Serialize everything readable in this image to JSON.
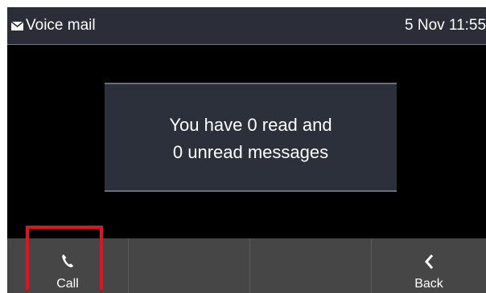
{
  "header": {
    "icon": "envelope-icon",
    "title": "Voice mail",
    "datetime": "5 Nov 11:55"
  },
  "dialog": {
    "line1": "You have 0 read and",
    "line2": "0 unread messages"
  },
  "softkeys": [
    {
      "label": "Call",
      "icon": "phone-handset-icon"
    },
    {
      "label": ""
    },
    {
      "label": ""
    },
    {
      "label": "Back",
      "icon": "chevron-left-icon"
    }
  ],
  "colors": {
    "header_bg": "#2b2d38",
    "header_accent": "#1e8fe0",
    "dialog_bg": "#2b303a",
    "softkey_bg": "#464646",
    "highlight": "#e8111b"
  }
}
